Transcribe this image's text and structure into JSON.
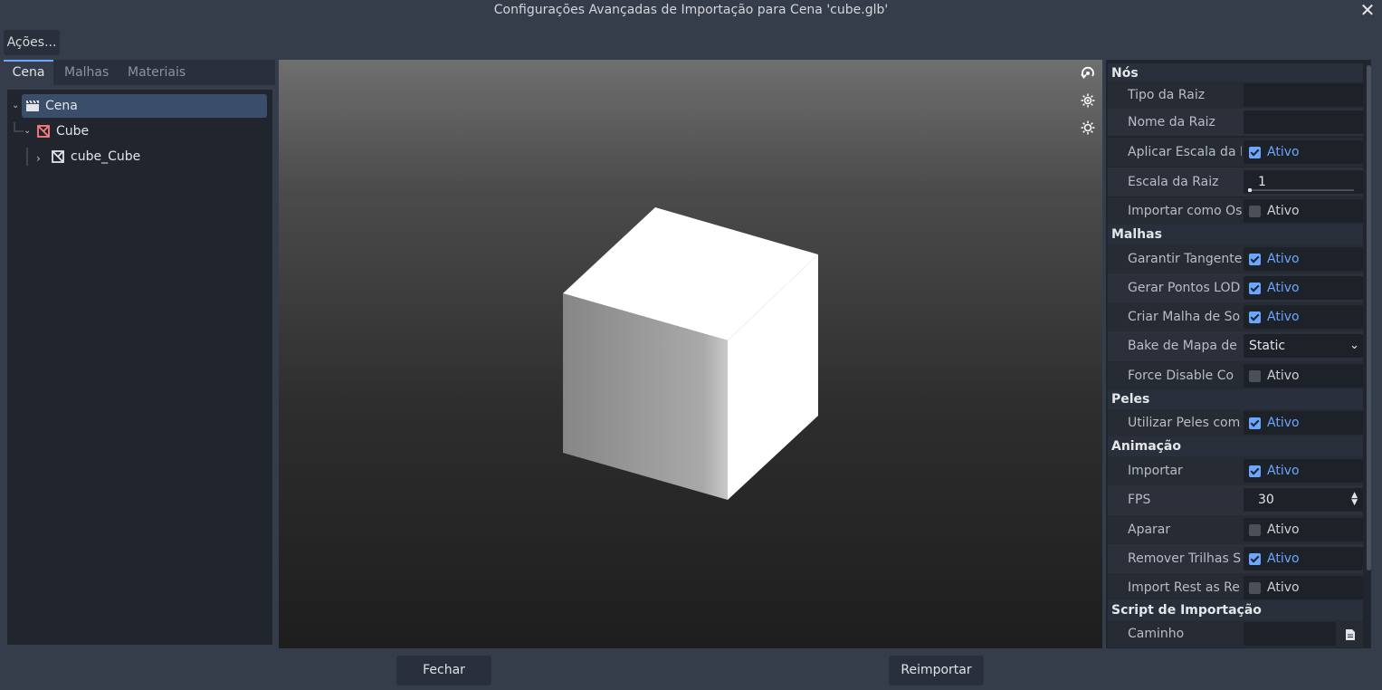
{
  "window": {
    "title": "Configurações Avançadas de Importação para Cena 'cube.glb'",
    "close_icon": "close-icon"
  },
  "actions_menu": {
    "label": "Ações..."
  },
  "tabs": [
    {
      "label": "Cena",
      "active": true
    },
    {
      "label": "Malhas",
      "active": false
    },
    {
      "label": "Materiais",
      "active": false
    }
  ],
  "tree": {
    "root": {
      "label": "Cena",
      "icon": "scene-clapper-icon"
    },
    "child": {
      "label": "Cube",
      "icon": "node3d-icon"
    },
    "grandchild": {
      "label": "cube_Cube",
      "icon": "mesh-instance-icon"
    }
  },
  "viewport": {
    "icons": [
      "orbit-icon",
      "sun-icon",
      "environment-icon"
    ]
  },
  "inspector": {
    "nos": {
      "header": "Nós",
      "tipo_raiz": "Tipo da Raiz",
      "nome_raiz": "Nome da Raiz",
      "aplicar_escala": {
        "label": "Aplicar Escala da R",
        "check": "Ativo",
        "checked": true
      },
      "escala_raiz": {
        "label": "Escala da Raiz",
        "value": "1"
      },
      "importar_os": {
        "label": "Importar como Os",
        "check": "Ativo",
        "checked": false
      }
    },
    "malhas": {
      "header": "Malhas",
      "garantir": {
        "label": "Garantir Tangente",
        "check": "Ativo",
        "checked": true
      },
      "gerar_lod": {
        "label": "Gerar Pontos LOD",
        "check": "Ativo",
        "checked": true
      },
      "criar_malha": {
        "label": "Criar Malha de So",
        "check": "Ativo",
        "checked": true
      },
      "bake_mapa": {
        "label": "Bake de Mapa de",
        "value": "Static"
      },
      "force_disable": {
        "label": "Force Disable Co",
        "check": "Ativo",
        "checked": false
      }
    },
    "peles": {
      "header": "Peles",
      "utilizar": {
        "label": "Utilizar Peles com",
        "check": "Ativo",
        "checked": true
      }
    },
    "animacao": {
      "header": "Animação",
      "importar": {
        "label": "Importar",
        "check": "Ativo",
        "checked": true
      },
      "fps": {
        "label": "FPS",
        "value": "30"
      },
      "aparar": {
        "label": "Aparar",
        "check": "Ativo",
        "checked": false
      },
      "remover": {
        "label": "Remover Trilhas S",
        "check": "Ativo",
        "checked": true
      },
      "import_rest": {
        "label": "Import Rest as Re",
        "check": "Ativo",
        "checked": false
      }
    },
    "script": {
      "header": "Script de Importação",
      "caminho": "Caminho"
    }
  },
  "buttons": {
    "close": "Fechar",
    "reimport": "Reimportar"
  },
  "colors": {
    "accent": "#6ba6ff",
    "background": "#363d4a",
    "panel": "#21262e"
  }
}
